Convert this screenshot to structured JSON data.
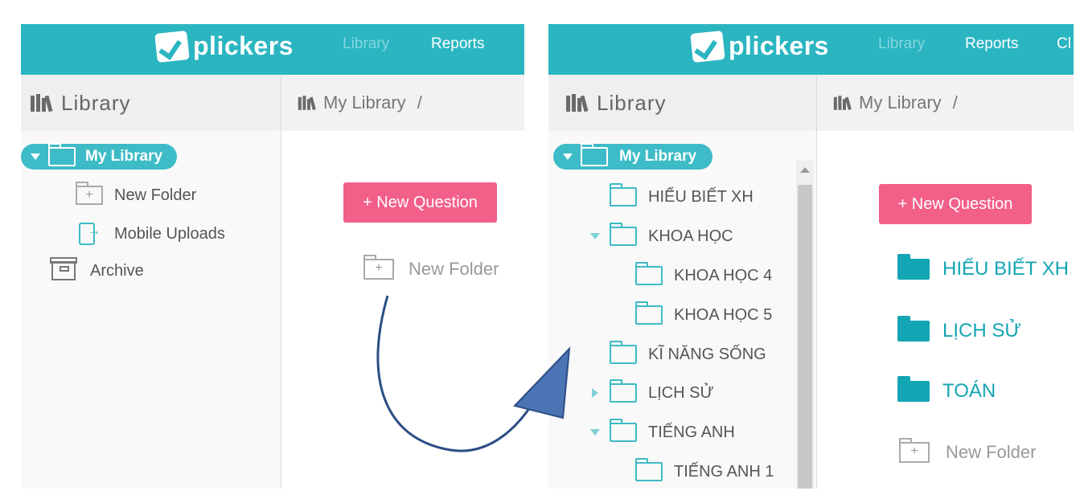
{
  "left_screen": {
    "navbar": {
      "logo_text": "plickers",
      "nav_items": [
        "Library",
        "Reports"
      ]
    },
    "sidebar": {
      "title": "Library",
      "tree": {
        "root_label": "My Library",
        "items": [
          {
            "label": "New Folder",
            "icon": "new-folder-icon"
          },
          {
            "label": "Mobile Uploads",
            "icon": "mobile-upload-icon"
          }
        ],
        "archive_label": "Archive"
      }
    },
    "main": {
      "breadcrumb": "My Library",
      "breadcrumb_sep": "/",
      "new_question_label": "+ New Question",
      "new_folder_label": "New Folder"
    }
  },
  "right_screen": {
    "navbar": {
      "logo_text": "plickers",
      "nav_items": [
        "Library",
        "Reports",
        "Cl"
      ]
    },
    "sidebar": {
      "title": "Library",
      "root_label": "My Library",
      "tree": [
        {
          "label": "HIỂU BIẾT XH",
          "level": 1,
          "expander": "none",
          "open": false
        },
        {
          "label": "KHOA HỌC",
          "level": 1,
          "expander": "down",
          "open": true
        },
        {
          "label": "KHOA HỌC 4",
          "level": 2,
          "expander": "none",
          "open": false
        },
        {
          "label": "KHOA HỌC 5",
          "level": 2,
          "expander": "none",
          "open": false
        },
        {
          "label": "KĨ NĂNG SỐNG",
          "level": 1,
          "expander": "none",
          "open": false
        },
        {
          "label": "LỊCH SỬ",
          "level": 1,
          "expander": "right",
          "open": false
        },
        {
          "label": "TIẾNG ANH",
          "level": 1,
          "expander": "down",
          "open": true
        },
        {
          "label": "TIẾNG ANH 1",
          "level": 2,
          "expander": "none",
          "open": false
        }
      ]
    },
    "main": {
      "breadcrumb": "My Library",
      "breadcrumb_sep": "/",
      "new_question_label": "+ New Question",
      "folders": [
        "HIỂU BIẾT XH",
        "LỊCH SỬ",
        "TOÁN"
      ],
      "new_folder_label": "New Folder"
    }
  },
  "colors": {
    "brand_teal": "#2ab5c1",
    "pill_teal": "#3dbbc6",
    "folder_teal": "#13a5b3",
    "button_pink": "#f25f88",
    "arrow_blue": "#4a74b4"
  }
}
